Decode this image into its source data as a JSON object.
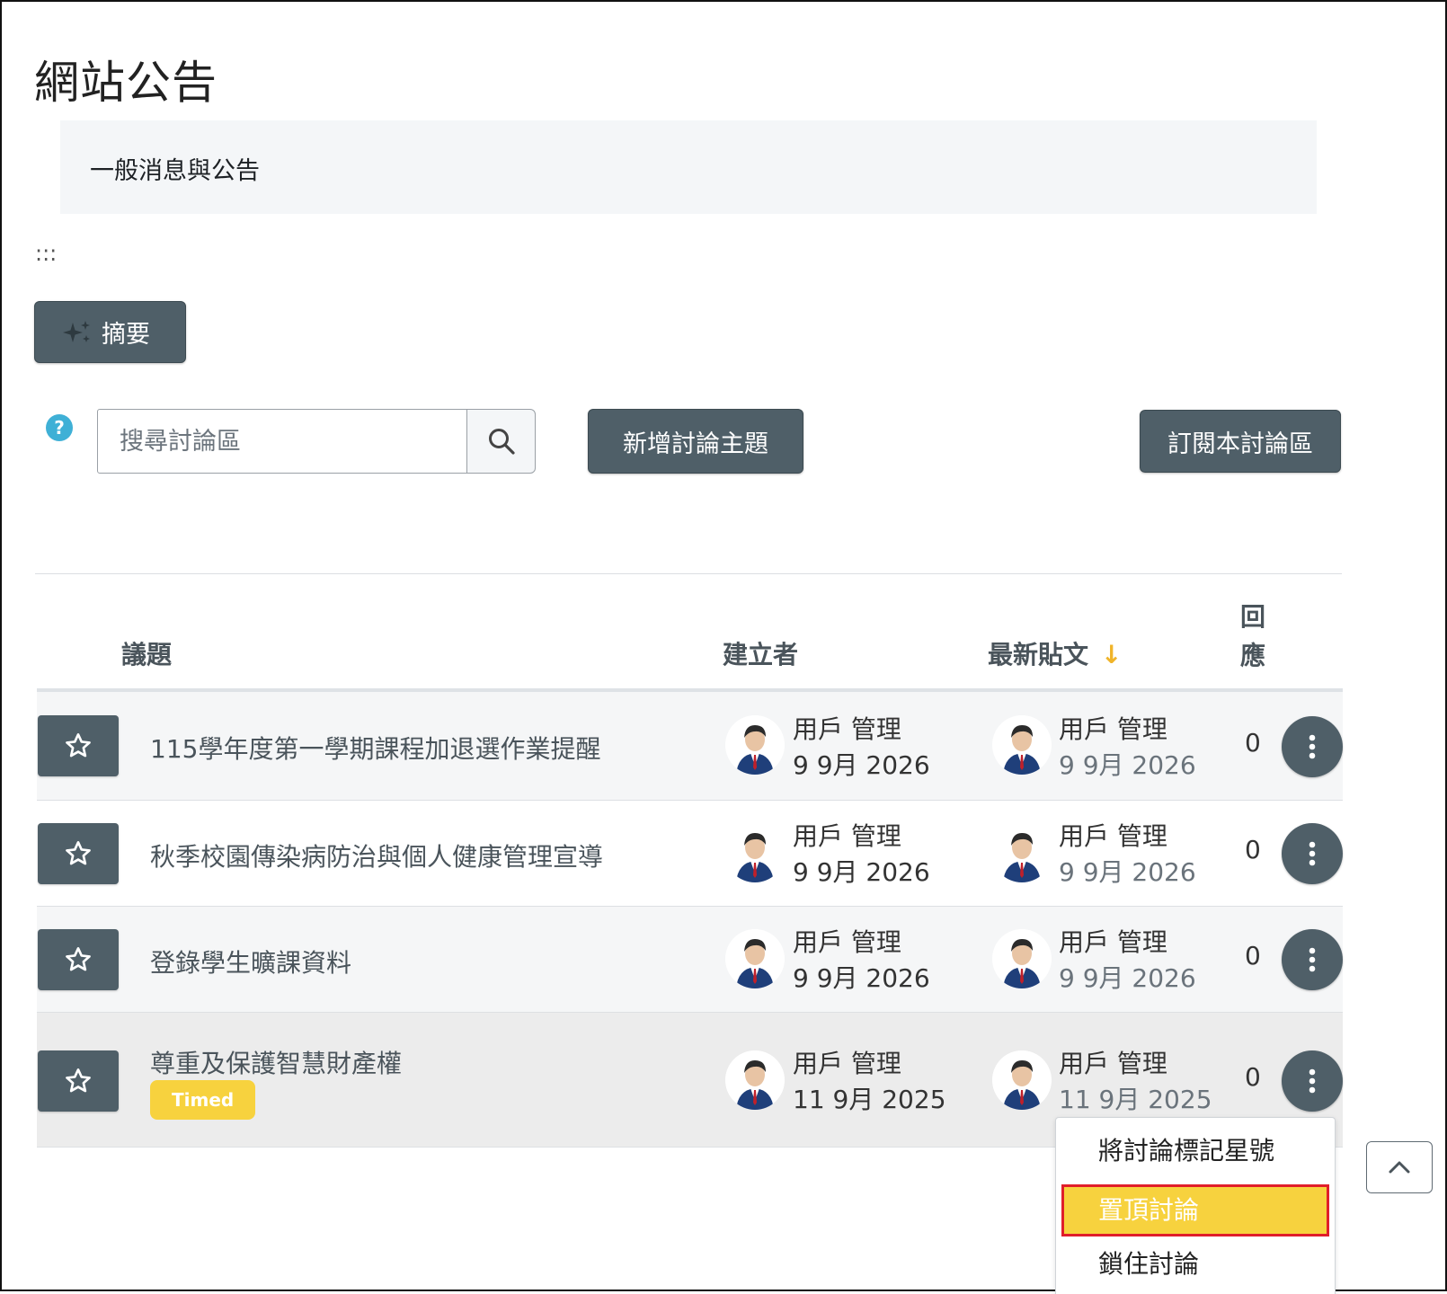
{
  "page": {
    "title": "網站公告",
    "intro": "一般消息與公告",
    "drag_handle": ":::"
  },
  "toolbar": {
    "summary_label": "摘要",
    "help_label": "?",
    "search_placeholder": "搜尋討論區",
    "new_topic_label": "新增討論主題",
    "subscribe_label": "訂閱本討論區"
  },
  "table": {
    "headers": {
      "topic": "議題",
      "creator": "建立者",
      "latest": "最新貼文",
      "sort_arrow": "↓",
      "replies": "回應"
    },
    "rows": [
      {
        "topic": "115學年度第一學期課程加退選作業提醒",
        "badge": "",
        "creator_name": "用戶 管理",
        "creator_date": "9 9月 2026",
        "latest_name": "用戶 管理",
        "latest_date": "9 9月 2026",
        "replies": "0"
      },
      {
        "topic": "秋季校園傳染病防治與個人健康管理宣導",
        "badge": "",
        "creator_name": "用戶 管理",
        "creator_date": "9 9月 2026",
        "latest_name": "用戶 管理",
        "latest_date": "9 9月 2026",
        "replies": "0"
      },
      {
        "topic": "登錄學生曠課資料",
        "badge": "",
        "creator_name": "用戶 管理",
        "creator_date": "9 9月 2026",
        "latest_name": "用戶 管理",
        "latest_date": "9 9月 2026",
        "replies": "0"
      },
      {
        "topic": "尊重及保護智慧財產權",
        "badge": "Timed",
        "creator_name": "用戶 管理",
        "creator_date": "11 9月 2025",
        "latest_name": "用戶 管理",
        "latest_date": "11 9月 2025",
        "replies": "0"
      }
    ]
  },
  "dropdown": {
    "items": [
      "將討論標記星號",
      "置頂討論",
      "鎖住討論"
    ],
    "highlighted_index": 1
  },
  "colors": {
    "dark_button": "#4f5f68",
    "badge_yellow": "#f7d23e",
    "highlight_border": "#e01e2a",
    "help_blue": "#3fb0d6",
    "sort_arrow": "#f0b429"
  }
}
